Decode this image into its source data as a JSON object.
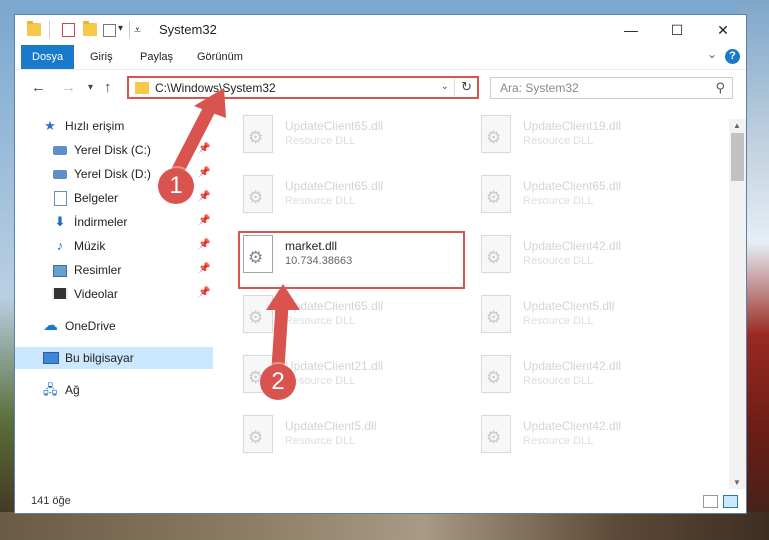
{
  "window": {
    "title": "System32"
  },
  "ribbon": {
    "tabs": [
      "Dosya",
      "Giriş",
      "Paylaş",
      "Görünüm"
    ],
    "help_label": "?"
  },
  "navigation": {
    "address_path": "C:\\Windows\\System32",
    "search_placeholder": "Ara: System32"
  },
  "sidebar": {
    "items": [
      {
        "label": "Hızlı erişim",
        "icon": "star-icon",
        "pinned": false
      },
      {
        "label": "Yerel Disk (C:)",
        "icon": "drive-icon",
        "pinned": true
      },
      {
        "label": "Yerel Disk (D:)",
        "icon": "drive-icon",
        "pinned": true
      },
      {
        "label": "Belgeler",
        "icon": "documents-icon",
        "pinned": true
      },
      {
        "label": "İndirmeler",
        "icon": "download-icon",
        "pinned": true
      },
      {
        "label": "Müzik",
        "icon": "music-icon",
        "pinned": true
      },
      {
        "label": "Resimler",
        "icon": "pictures-icon",
        "pinned": true
      },
      {
        "label": "Videolar",
        "icon": "videos-icon",
        "pinned": true
      },
      {
        "label": "OneDrive",
        "icon": "cloud-icon",
        "pinned": false
      },
      {
        "label": "Bu bilgisayar",
        "icon": "computer-icon",
        "pinned": false,
        "selected": true
      },
      {
        "label": "Ağ",
        "icon": "network-icon",
        "pinned": false
      }
    ]
  },
  "files": [
    {
      "name": "UpdateClient65.dll",
      "sub": "Resource DLL"
    },
    {
      "name": "UpdateClient19.dll",
      "sub": "Resource DLL"
    },
    {
      "name": "UpdateClient65.dll",
      "sub": "Resource DLL"
    },
    {
      "name": "UpdateClient65.dll",
      "sub": "Resource DLL"
    },
    {
      "name": "market.dll",
      "sub": "10.734.38663",
      "highlighted": true
    },
    {
      "name": "UpdateClient42.dll",
      "sub": "Resource DLL"
    },
    {
      "name": "UpdateClient65.dll",
      "sub": "Resource DLL"
    },
    {
      "name": "UpdateClient5.dll",
      "sub": "Resource DLL"
    },
    {
      "name": "UpdateClient21.dll",
      "sub": "Resource DLL"
    },
    {
      "name": "UpdateClient42.dll",
      "sub": "Resource DLL"
    },
    {
      "name": "UpdateClient5.dll",
      "sub": "Resource DLL"
    },
    {
      "name": "UpdateClient42.dll",
      "sub": "Resource DLL"
    }
  ],
  "status": {
    "item_count": "141 öğe"
  },
  "annotations": {
    "step1": "1",
    "step2": "2"
  },
  "colors": {
    "accent": "#1979ca",
    "highlight": "#d9534f",
    "selected": "#cce8ff"
  }
}
